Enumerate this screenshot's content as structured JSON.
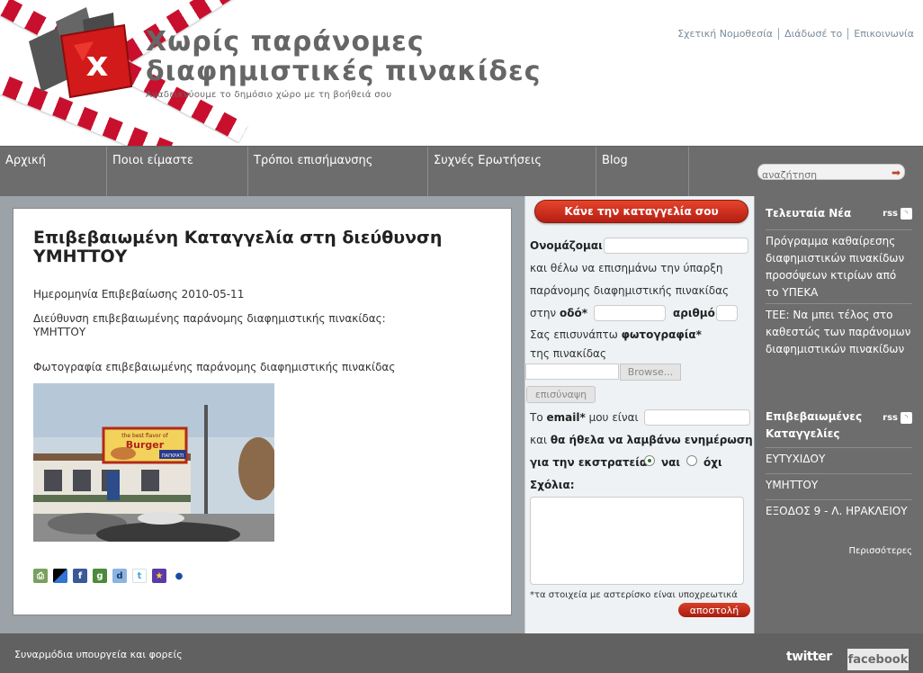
{
  "header": {
    "title_line1": "Χωρίς παράνομες",
    "title_line2": "διαφημιστικές πινακίδες",
    "tagline": "Αναδεικνύουμε το δημόσιο χώρο με τη βοήθειά σου",
    "top_links": [
      "Σχετική Νομοθεσία",
      "Διάδωσέ το",
      "Επικοινωνία"
    ]
  },
  "nav": {
    "items": [
      "Αρχική",
      "Ποιοι είμαστε",
      "Τρόποι επισήμανσης",
      "Συχνές Ερωτήσεις",
      "Blog"
    ],
    "search_placeholder": "αναζήτηση"
  },
  "content": {
    "title": "Επιβεβαιωμένη Καταγγελία στη διεύθυνση ΥΜΗΤΤΟΥ",
    "date_line": "Ημερομηνία Επιβεβαίωσης 2010-05-11",
    "address_label": "Διεύθυνση επιβεβαιωμένης παράνομης διαφημιστικής πινακίδας:",
    "address_value": "ΥΜΗΤΤΟΥ",
    "photo_label": "Φωτογραφία επιβεβαιωμένης παράνομης διαφημιστικής πινακίδας",
    "billboard_small": "the best flavor of",
    "billboard_big": "Burger",
    "billboard_shop": "ΠΑΓΚΡΑΤΙ"
  },
  "form": {
    "report_button": "Κάνε την καταγγελία σου",
    "name_label": "Ονομάζομαι",
    "line2": "και θέλω να επισημάνω την ύπαρξη",
    "line3": "παράνομης διαφημιστικής πινακίδας",
    "street_prefix": "στην",
    "street_label": "οδό*",
    "number_label": "αριθμό",
    "photo_prefix": "Σας επισυνάπτω",
    "photo_label": "φωτογραφία*",
    "photo_suffix": "της πινακίδας",
    "browse": "Browse...",
    "attach": "επισύναψη",
    "email_prefix": "Το",
    "email_label": "email*",
    "email_suffix": "μου είναι",
    "updates_prefix": "και",
    "updates_line1": "θα ήθελα να λαμβάνω ενημέρωση",
    "updates_line2": "για την εκστρατεία",
    "yes": "ναι",
    "no": "όχι",
    "comments_label": "Σχόλια:",
    "required_note": "*τα στοιχεία με αστερίσκο είναι υποχρεωτικά",
    "submit": "αποστολή"
  },
  "sidebar": {
    "news_title": "Τελευταία Νέα",
    "rss": "rss",
    "news_items": [
      "Πρόγραμμα καθαίρεσης διαφημιστικών πινακίδων προσόψεων κτιρίων από το ΥΠΕΚΑ",
      "ΤΕΕ: Να μπει τέλος στο καθεστώς των παράνομων διαφημιστικών πινακίδων"
    ],
    "confirmed_title_line1": "Επιβεβαιωμένες",
    "confirmed_title_line2": "Καταγγελίες",
    "confirmed_items": [
      "ΕΥΤΥΧΙΔΟΥ",
      "ΥΜΗΤΤΟΥ",
      "ΕΞΟΔΟΣ 9 - Λ. ΗΡΑΚΛΕΙΟΥ"
    ],
    "more": "Περισσότερες"
  },
  "footer": {
    "text": "Συναρμόδια υπουργεία και φορείς",
    "twitter": "twitter",
    "facebook": "facebook"
  },
  "colors": {
    "brand_red": "#c8102e",
    "nav_gray": "#6d6d6d",
    "page_gray": "#9ba2a8"
  },
  "icons": [
    "logo-x-sign",
    "search-arrow-icon",
    "rss-icon",
    "print-icon",
    "delicious-icon",
    "facebook-icon",
    "google-icon",
    "digg-icon",
    "twitter-icon",
    "favorite-icon",
    "myspace-icon"
  ]
}
